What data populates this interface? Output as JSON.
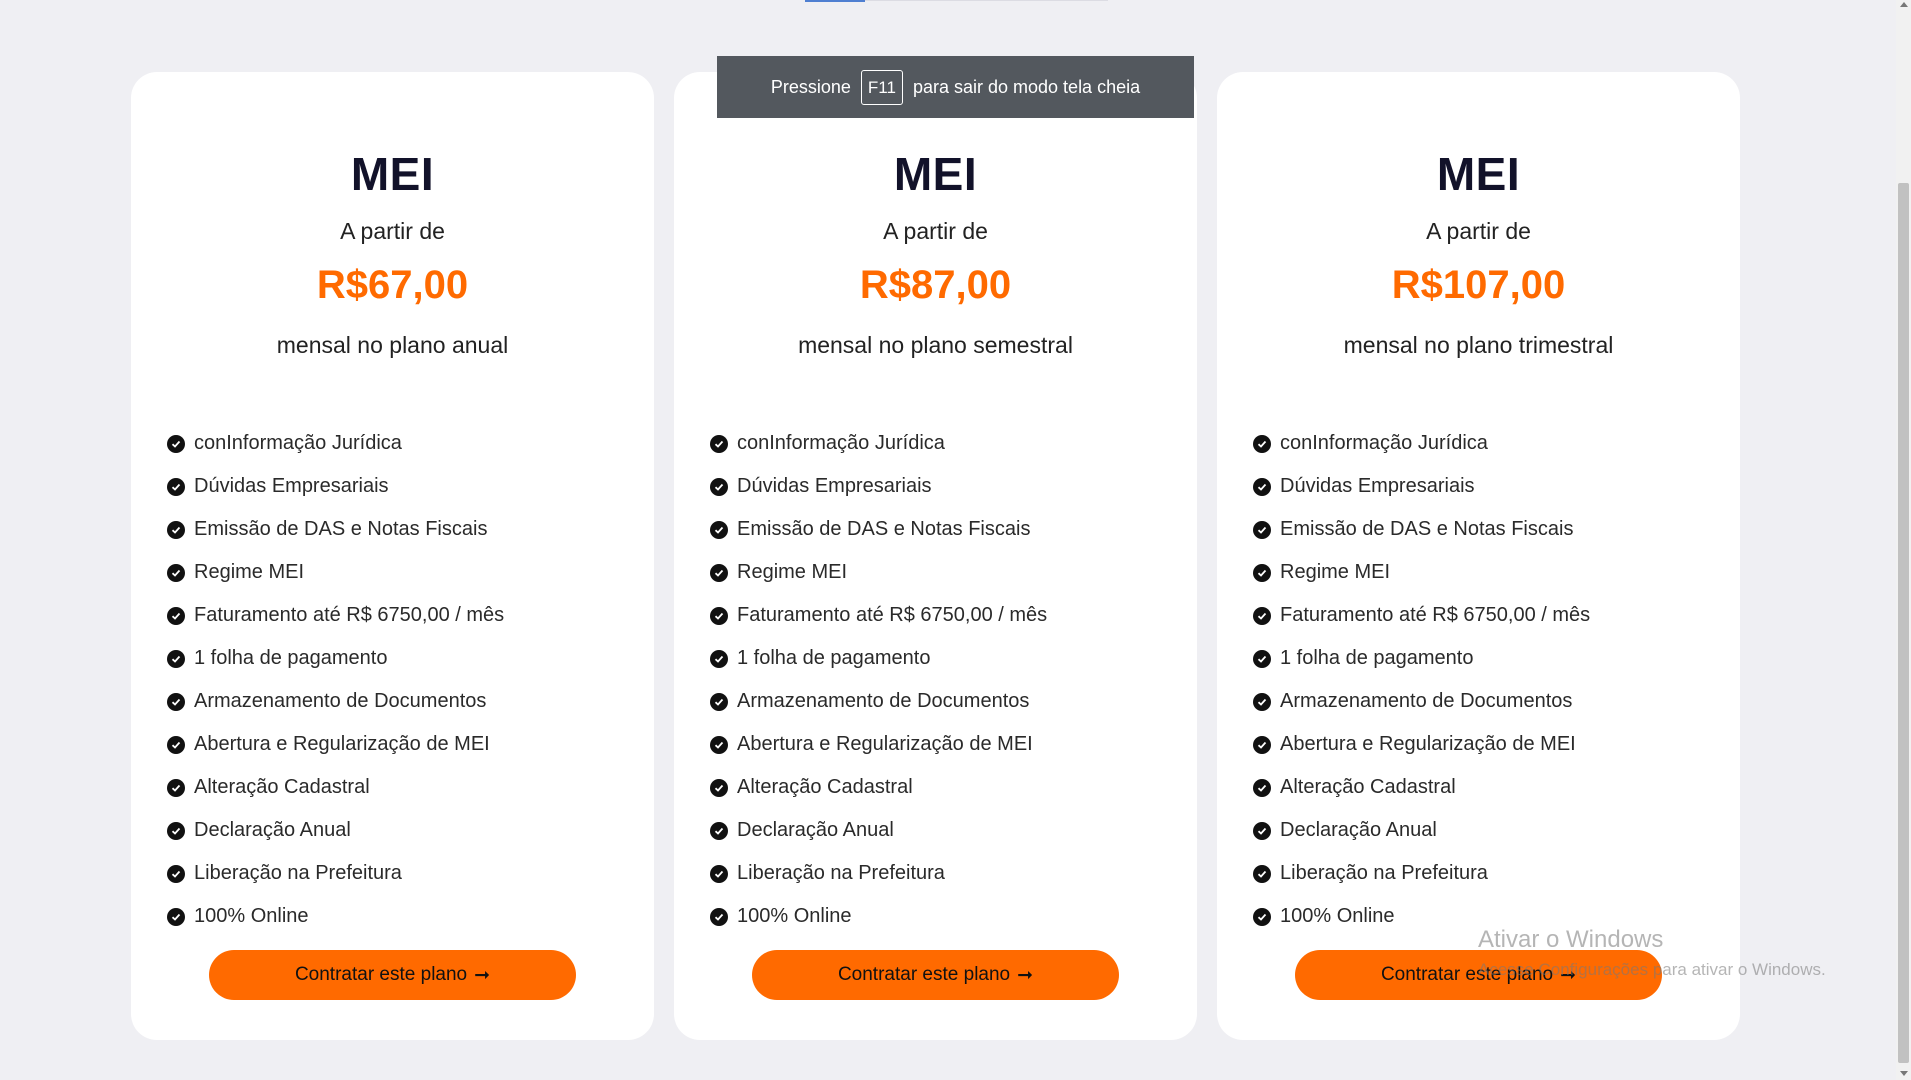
{
  "f11_toast": {
    "before": "Pressione",
    "key": "F11",
    "after": "para sair do modo tela cheia"
  },
  "plans": [
    {
      "title": "MEI",
      "from": "A partir de",
      "price": "R$67,00",
      "period": "mensal no plano anual",
      "features": [
        "conInformação Jurídica",
        "Dúvidas Empresariais",
        "Emissão de DAS e Notas Fiscais",
        "Regime MEI",
        "Faturamento até R$ 6750,00 / mês",
        "1 folha de pagamento",
        "Armazenamento de Documentos",
        "Abertura e Regularização de MEI",
        "Alteração Cadastral",
        "Declaração Anual",
        "Liberação na Prefeitura",
        "100% Online"
      ],
      "cta": "Contratar este plano"
    },
    {
      "title": "MEI",
      "from": "A partir de",
      "price": "R$87,00",
      "period": "mensal no plano semestral",
      "features": [
        "conInformação Jurídica",
        "Dúvidas Empresariais",
        "Emissão de DAS e Notas Fiscais",
        "Regime MEI",
        "Faturamento até R$ 6750,00 / mês",
        "1 folha de pagamento",
        "Armazenamento de Documentos",
        "Abertura e Regularização de MEI",
        "Alteração Cadastral",
        "Declaração Anual",
        "Liberação na Prefeitura",
        "100% Online"
      ],
      "cta": "Contratar este plano"
    },
    {
      "title": "MEI",
      "from": "A partir de",
      "price": "R$107,00",
      "period": "mensal no plano trimestral",
      "features": [
        "conInformação Jurídica",
        "Dúvidas Empresariais",
        "Emissão de DAS e Notas Fiscais",
        "Regime MEI",
        "Faturamento até R$ 6750,00 / mês",
        "1 folha de pagamento",
        "Armazenamento de Documentos",
        "Abertura e Regularização de MEI",
        "Alteração Cadastral",
        "Declaração Anual",
        "Liberação na Prefeitura",
        "100% Online"
      ],
      "cta": "Contratar este plano"
    }
  ],
  "windows_watermark": {
    "title": "Ativar o Windows",
    "subtitle": "Acesse Configurações para ativar o Windows."
  },
  "colors": {
    "accent": "#ff6a00",
    "background": "#efeff3",
    "card": "#ffffff",
    "title": "#12122a"
  }
}
